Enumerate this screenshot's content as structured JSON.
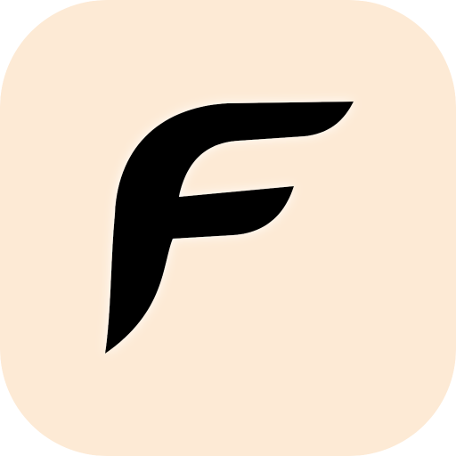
{
  "icon": {
    "semantic_name": "letter-f-logo-icon",
    "logo_lettering": "F",
    "colors": {
      "tile_background": "#FDEAD5",
      "glyph": "#000000",
      "glow": "#FFFFFF"
    }
  }
}
